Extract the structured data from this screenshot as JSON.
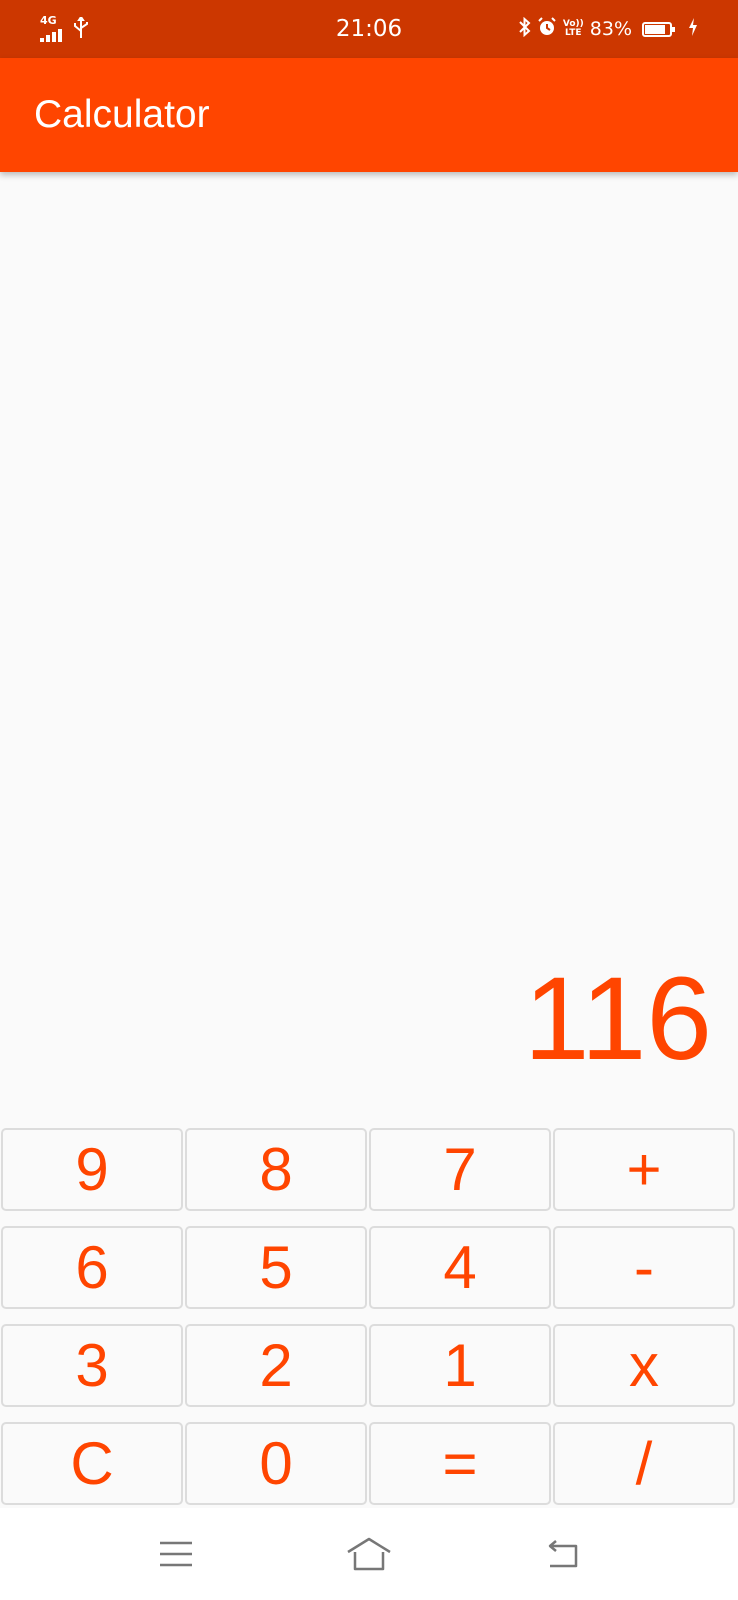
{
  "status_bar": {
    "network": "4G",
    "time": "21:06",
    "volte_top": "Vo))",
    "volte_bottom": "LTE",
    "battery_percent": "83%",
    "battery_level": 0.83,
    "icons": [
      "signal-icon",
      "usb-icon",
      "bluetooth-icon",
      "alarm-icon",
      "volte-icon",
      "battery-icon",
      "charging-icon"
    ]
  },
  "app_bar": {
    "title": "Calculator"
  },
  "display": {
    "value": "116"
  },
  "keypad": {
    "keys": [
      "9",
      "8",
      "7",
      "+",
      "6",
      "5",
      "4",
      "-",
      "3",
      "2",
      "1",
      "x",
      "C",
      "0",
      "=",
      "/"
    ]
  },
  "nav_bar": {
    "icons": [
      "menu-icon",
      "home-icon",
      "back-icon"
    ]
  },
  "colors": {
    "status_bar": "#cc3700",
    "accent": "#ff4500",
    "background": "#fafafa",
    "key_border": "#dcdcdc"
  }
}
